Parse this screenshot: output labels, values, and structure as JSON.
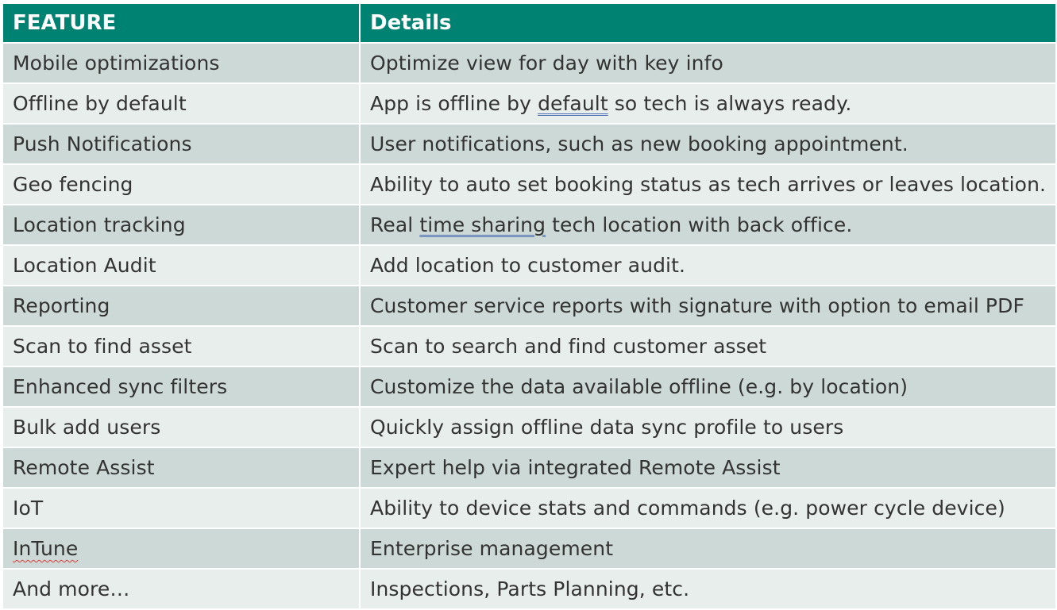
{
  "header": {
    "col1": "FEATURE",
    "col2": "Details"
  },
  "rows": [
    {
      "feature": "Mobile optimizations",
      "details": "Optimize view for day with key info"
    },
    {
      "feature": "Offline by default",
      "details_pre": "App is offline by ",
      "details_mark": "default",
      "details_post": " so tech is always ready."
    },
    {
      "feature": "Push Notifications",
      "details": "User notifications, such as new booking appointment."
    },
    {
      "feature": "Geo fencing",
      "details": "Ability to auto set booking status as tech arrives or leaves location."
    },
    {
      "feature": "Location tracking",
      "details_pre": "Real ",
      "details_mark": "time sharing",
      "details_post": " tech location with back office."
    },
    {
      "feature": "Location Audit",
      "details": "Add location to customer audit."
    },
    {
      "feature": "Reporting",
      "details": "Customer service reports with signature with option to email PDF"
    },
    {
      "feature": "Scan to find asset",
      "details": "Scan to search and find customer asset"
    },
    {
      "feature": "Enhanced sync filters",
      "details": "Customize the data available offline (e.g. by location)"
    },
    {
      "feature": "Bulk add users",
      "details": "Quickly assign offline data sync profile to users"
    },
    {
      "feature": "Remote Assist",
      "details": "Expert help via integrated Remote Assist"
    },
    {
      "feature": "IoT",
      "details": "Ability to device stats and commands (e.g. power cycle device)"
    },
    {
      "feature": "InTune",
      "details": "Enterprise management"
    },
    {
      "feature": "And more…",
      "details": "Inspections, Parts Planning, etc."
    }
  ],
  "colors": {
    "header_bg": "#008272",
    "row_dark": "#cdd9d6",
    "row_light": "#e8eeec"
  }
}
